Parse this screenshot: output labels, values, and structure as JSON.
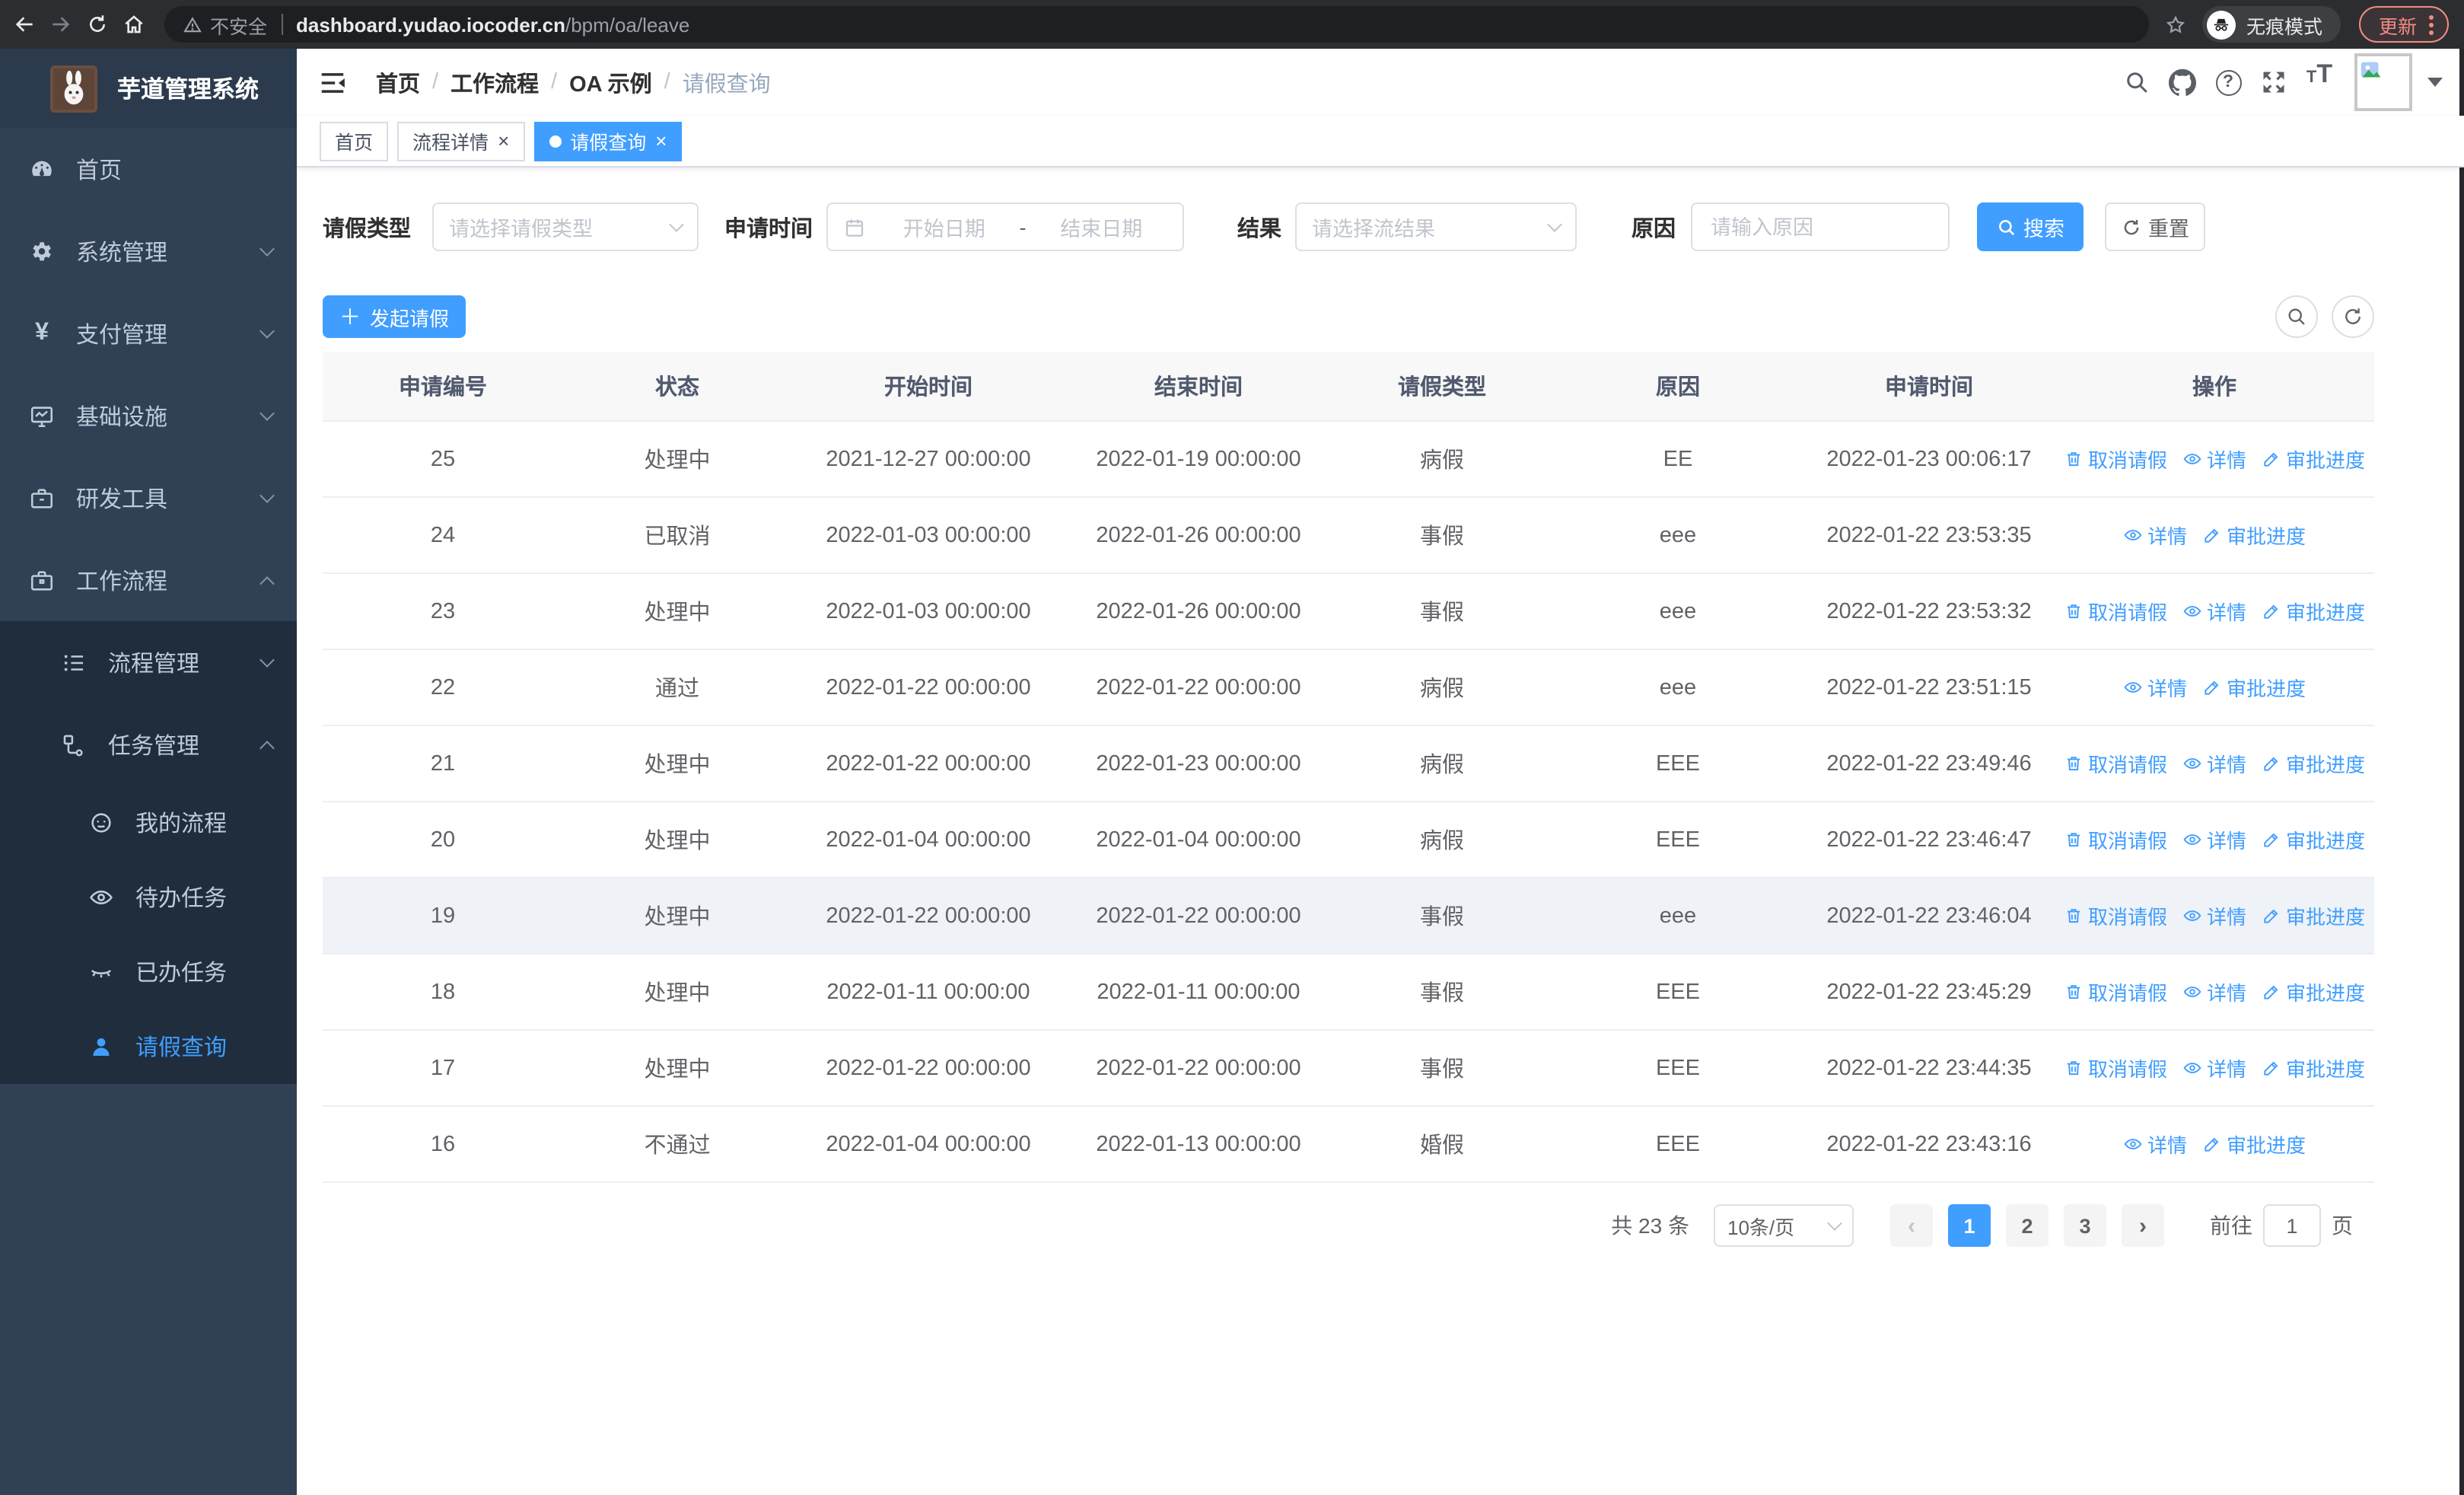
{
  "browser": {
    "security_label": "不安全",
    "url_host": "dashboard.yudao.iocoder.cn",
    "url_path": "/bpm/oa/leave",
    "incognito_label": "无痕模式",
    "update_label": "更新"
  },
  "colors": {
    "accent": "#409eff",
    "sidebar_bg": "#304156",
    "submenu_bg": "#1f2d3d",
    "link_blue": "#409eff",
    "update_pill": "#f28b82"
  },
  "sidebar": {
    "app_title": "芋道管理系统",
    "items": [
      {
        "label": "首页",
        "icon": "dashboard-icon"
      },
      {
        "label": "系统管理",
        "icon": "gear-icon",
        "chevron": "down"
      },
      {
        "label": "支付管理",
        "icon": "yen-icon",
        "chevron": "down"
      },
      {
        "label": "基础设施",
        "icon": "monitor-icon",
        "chevron": "down"
      },
      {
        "label": "研发工具",
        "icon": "toolbox-icon",
        "chevron": "down"
      },
      {
        "label": "工作流程",
        "icon": "briefcase-icon",
        "chevron": "up"
      },
      {
        "label": "流程管理",
        "icon": "process-list-icon",
        "chevron": "down"
      },
      {
        "label": "任务管理",
        "icon": "task-flow-icon",
        "chevron": "up"
      },
      {
        "label": "我的流程",
        "icon": "face-icon"
      },
      {
        "label": "待办任务",
        "icon": "eye-open-icon"
      },
      {
        "label": "已办任务",
        "icon": "eye-closed-icon"
      },
      {
        "label": "请假查询",
        "icon": "user-icon",
        "active": true
      }
    ]
  },
  "breadcrumb": {
    "items": [
      "首页",
      "工作流程",
      "OA 示例",
      "请假查询"
    ]
  },
  "tabs": [
    {
      "label": "首页",
      "closable": false,
      "active": false
    },
    {
      "label": "流程详情",
      "closable": true,
      "active": false
    },
    {
      "label": "请假查询",
      "closable": true,
      "active": true
    }
  ],
  "filters": {
    "leave_type_label": "请假类型",
    "leave_type_placeholder": "请选择请假类型",
    "apply_time_label": "申请时间",
    "start_date_placeholder": "开始日期",
    "range_separator": "-",
    "end_date_placeholder": "结束日期",
    "result_label": "结果",
    "result_placeholder": "请选择流结果",
    "reason_label": "原因",
    "reason_placeholder": "请输入原因",
    "search_label": "搜索",
    "reset_label": "重置"
  },
  "toolbar": {
    "create_label": "发起请假"
  },
  "table": {
    "columns": [
      "申请编号",
      "状态",
      "开始时间",
      "结束时间",
      "请假类型",
      "原因",
      "申请时间",
      "操作"
    ],
    "ops": {
      "cancel": "取消请假",
      "detail": "详情",
      "progress": "审批进度"
    },
    "rows": [
      {
        "id": "25",
        "status": "处理中",
        "start": "2021-12-27 00:00:00",
        "end": "2022-01-19 00:00:00",
        "type": "病假",
        "reason": "EE",
        "apply_time": "2022-01-23 00:06:17",
        "can_cancel": true,
        "hover": false
      },
      {
        "id": "24",
        "status": "已取消",
        "start": "2022-01-03 00:00:00",
        "end": "2022-01-26 00:00:00",
        "type": "事假",
        "reason": "eee",
        "apply_time": "2022-01-22 23:53:35",
        "can_cancel": false,
        "hover": false
      },
      {
        "id": "23",
        "status": "处理中",
        "start": "2022-01-03 00:00:00",
        "end": "2022-01-26 00:00:00",
        "type": "事假",
        "reason": "eee",
        "apply_time": "2022-01-22 23:53:32",
        "can_cancel": true,
        "hover": false
      },
      {
        "id": "22",
        "status": "通过",
        "start": "2022-01-22 00:00:00",
        "end": "2022-01-22 00:00:00",
        "type": "病假",
        "reason": "eee",
        "apply_time": "2022-01-22 23:51:15",
        "can_cancel": false,
        "hover": false
      },
      {
        "id": "21",
        "status": "处理中",
        "start": "2022-01-22 00:00:00",
        "end": "2022-01-23 00:00:00",
        "type": "病假",
        "reason": "EEE",
        "apply_time": "2022-01-22 23:49:46",
        "can_cancel": true,
        "hover": false
      },
      {
        "id": "20",
        "status": "处理中",
        "start": "2022-01-04 00:00:00",
        "end": "2022-01-04 00:00:00",
        "type": "病假",
        "reason": "EEE",
        "apply_time": "2022-01-22 23:46:47",
        "can_cancel": true,
        "hover": false
      },
      {
        "id": "19",
        "status": "处理中",
        "start": "2022-01-22 00:00:00",
        "end": "2022-01-22 00:00:00",
        "type": "事假",
        "reason": "eee",
        "apply_time": "2022-01-22 23:46:04",
        "can_cancel": true,
        "hover": true
      },
      {
        "id": "18",
        "status": "处理中",
        "start": "2022-01-11 00:00:00",
        "end": "2022-01-11 00:00:00",
        "type": "事假",
        "reason": "EEE",
        "apply_time": "2022-01-22 23:45:29",
        "can_cancel": true,
        "hover": false
      },
      {
        "id": "17",
        "status": "处理中",
        "start": "2022-01-22 00:00:00",
        "end": "2022-01-22 00:00:00",
        "type": "事假",
        "reason": "EEE",
        "apply_time": "2022-01-22 23:44:35",
        "can_cancel": true,
        "hover": false
      },
      {
        "id": "16",
        "status": "不通过",
        "start": "2022-01-04 00:00:00",
        "end": "2022-01-13 00:00:00",
        "type": "婚假",
        "reason": "EEE",
        "apply_time": "2022-01-22 23:43:16",
        "can_cancel": false,
        "hover": false
      }
    ]
  },
  "pagination": {
    "total_label": "共 23 条",
    "page_size": "10条/页",
    "pages": [
      "1",
      "2",
      "3"
    ],
    "active_page": "1",
    "goto_label": "前往",
    "goto_value": "1",
    "page_suffix_label": "页"
  }
}
